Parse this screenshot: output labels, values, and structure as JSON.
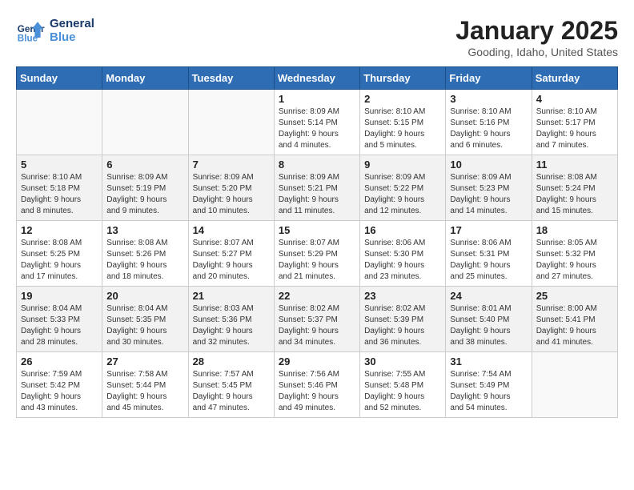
{
  "logo": {
    "line1": "General",
    "line2": "Blue"
  },
  "title": "January 2025",
  "subtitle": "Gooding, Idaho, United States",
  "weekdays": [
    "Sunday",
    "Monday",
    "Tuesday",
    "Wednesday",
    "Thursday",
    "Friday",
    "Saturday"
  ],
  "weeks": [
    [
      {
        "day": "",
        "info": ""
      },
      {
        "day": "",
        "info": ""
      },
      {
        "day": "",
        "info": ""
      },
      {
        "day": "1",
        "info": "Sunrise: 8:09 AM\nSunset: 5:14 PM\nDaylight: 9 hours\nand 4 minutes."
      },
      {
        "day": "2",
        "info": "Sunrise: 8:10 AM\nSunset: 5:15 PM\nDaylight: 9 hours\nand 5 minutes."
      },
      {
        "day": "3",
        "info": "Sunrise: 8:10 AM\nSunset: 5:16 PM\nDaylight: 9 hours\nand 6 minutes."
      },
      {
        "day": "4",
        "info": "Sunrise: 8:10 AM\nSunset: 5:17 PM\nDaylight: 9 hours\nand 7 minutes."
      }
    ],
    [
      {
        "day": "5",
        "info": "Sunrise: 8:10 AM\nSunset: 5:18 PM\nDaylight: 9 hours\nand 8 minutes."
      },
      {
        "day": "6",
        "info": "Sunrise: 8:09 AM\nSunset: 5:19 PM\nDaylight: 9 hours\nand 9 minutes."
      },
      {
        "day": "7",
        "info": "Sunrise: 8:09 AM\nSunset: 5:20 PM\nDaylight: 9 hours\nand 10 minutes."
      },
      {
        "day": "8",
        "info": "Sunrise: 8:09 AM\nSunset: 5:21 PM\nDaylight: 9 hours\nand 11 minutes."
      },
      {
        "day": "9",
        "info": "Sunrise: 8:09 AM\nSunset: 5:22 PM\nDaylight: 9 hours\nand 12 minutes."
      },
      {
        "day": "10",
        "info": "Sunrise: 8:09 AM\nSunset: 5:23 PM\nDaylight: 9 hours\nand 14 minutes."
      },
      {
        "day": "11",
        "info": "Sunrise: 8:08 AM\nSunset: 5:24 PM\nDaylight: 9 hours\nand 15 minutes."
      }
    ],
    [
      {
        "day": "12",
        "info": "Sunrise: 8:08 AM\nSunset: 5:25 PM\nDaylight: 9 hours\nand 17 minutes."
      },
      {
        "day": "13",
        "info": "Sunrise: 8:08 AM\nSunset: 5:26 PM\nDaylight: 9 hours\nand 18 minutes."
      },
      {
        "day": "14",
        "info": "Sunrise: 8:07 AM\nSunset: 5:27 PM\nDaylight: 9 hours\nand 20 minutes."
      },
      {
        "day": "15",
        "info": "Sunrise: 8:07 AM\nSunset: 5:29 PM\nDaylight: 9 hours\nand 21 minutes."
      },
      {
        "day": "16",
        "info": "Sunrise: 8:06 AM\nSunset: 5:30 PM\nDaylight: 9 hours\nand 23 minutes."
      },
      {
        "day": "17",
        "info": "Sunrise: 8:06 AM\nSunset: 5:31 PM\nDaylight: 9 hours\nand 25 minutes."
      },
      {
        "day": "18",
        "info": "Sunrise: 8:05 AM\nSunset: 5:32 PM\nDaylight: 9 hours\nand 27 minutes."
      }
    ],
    [
      {
        "day": "19",
        "info": "Sunrise: 8:04 AM\nSunset: 5:33 PM\nDaylight: 9 hours\nand 28 minutes."
      },
      {
        "day": "20",
        "info": "Sunrise: 8:04 AM\nSunset: 5:35 PM\nDaylight: 9 hours\nand 30 minutes."
      },
      {
        "day": "21",
        "info": "Sunrise: 8:03 AM\nSunset: 5:36 PM\nDaylight: 9 hours\nand 32 minutes."
      },
      {
        "day": "22",
        "info": "Sunrise: 8:02 AM\nSunset: 5:37 PM\nDaylight: 9 hours\nand 34 minutes."
      },
      {
        "day": "23",
        "info": "Sunrise: 8:02 AM\nSunset: 5:39 PM\nDaylight: 9 hours\nand 36 minutes."
      },
      {
        "day": "24",
        "info": "Sunrise: 8:01 AM\nSunset: 5:40 PM\nDaylight: 9 hours\nand 38 minutes."
      },
      {
        "day": "25",
        "info": "Sunrise: 8:00 AM\nSunset: 5:41 PM\nDaylight: 9 hours\nand 41 minutes."
      }
    ],
    [
      {
        "day": "26",
        "info": "Sunrise: 7:59 AM\nSunset: 5:42 PM\nDaylight: 9 hours\nand 43 minutes."
      },
      {
        "day": "27",
        "info": "Sunrise: 7:58 AM\nSunset: 5:44 PM\nDaylight: 9 hours\nand 45 minutes."
      },
      {
        "day": "28",
        "info": "Sunrise: 7:57 AM\nSunset: 5:45 PM\nDaylight: 9 hours\nand 47 minutes."
      },
      {
        "day": "29",
        "info": "Sunrise: 7:56 AM\nSunset: 5:46 PM\nDaylight: 9 hours\nand 49 minutes."
      },
      {
        "day": "30",
        "info": "Sunrise: 7:55 AM\nSunset: 5:48 PM\nDaylight: 9 hours\nand 52 minutes."
      },
      {
        "day": "31",
        "info": "Sunrise: 7:54 AM\nSunset: 5:49 PM\nDaylight: 9 hours\nand 54 minutes."
      },
      {
        "day": "",
        "info": ""
      }
    ]
  ]
}
